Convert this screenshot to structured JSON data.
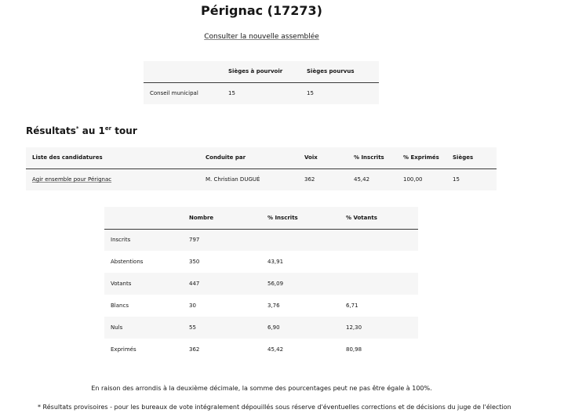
{
  "title": "Pérignac (17273)",
  "new_assembly_link": "Consulter la nouvelle assemblée",
  "sieges_table": {
    "headers": [
      "",
      "Sièges à pourvoir",
      "Sièges pourvus"
    ],
    "rows": [
      [
        "Conseil municipal",
        "15",
        "15"
      ]
    ]
  },
  "results_heading": {
    "prefix": "Résultats",
    "star": "*",
    "middle": " au 1",
    "sup": "er",
    "suffix": " tour"
  },
  "results_table": {
    "headers": [
      "Liste des candidatures",
      "Conduite par",
      "Voix",
      "% Inscrits",
      "% Exprimés",
      "Sièges"
    ],
    "rows": [
      [
        "Agir ensemble pour Pérignac",
        "M. Christian DUGUÉ",
        "362",
        "45,42",
        "100,00",
        "15"
      ]
    ]
  },
  "participation_table": {
    "headers": [
      "",
      "Nombre",
      "% Inscrits",
      "% Votants"
    ],
    "rows": [
      [
        "Inscrits",
        "797",
        "",
        ""
      ],
      [
        "Abstentions",
        "350",
        "43,91",
        ""
      ],
      [
        "Votants",
        "447",
        "56,09",
        ""
      ],
      [
        "Blancs",
        "30",
        "3,76",
        "6,71"
      ],
      [
        "Nuls",
        "55",
        "6,90",
        "12,30"
      ],
      [
        "Exprimés",
        "362",
        "45,42",
        "80,98"
      ]
    ]
  },
  "note_rounding": "En raison des arrondis à la deuxième décimale, la somme des pourcentages peut ne pas être égale à 100%.",
  "note_provisional": "* Résultats provisoires - pour les bureaux de vote intégralement dépouillés sous réserve d'éventuelles corrections et de décisions du juge de l'élection"
}
